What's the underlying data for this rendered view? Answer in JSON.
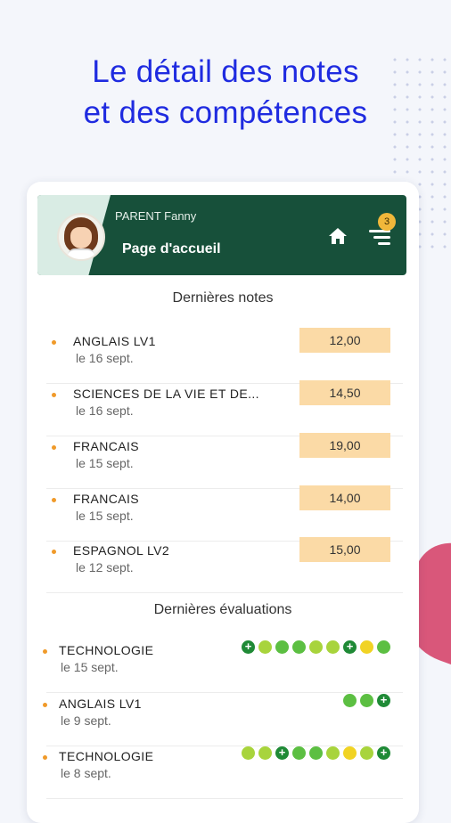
{
  "headline": {
    "line1": "Le détail des notes",
    "line2": "et des compétences"
  },
  "header": {
    "user": "PARENT Fanny",
    "page_title": "Page d'accueil",
    "notification_count": "3"
  },
  "notes": {
    "title": "Dernières notes",
    "items": [
      {
        "subject": "ANGLAIS LV1",
        "date": "le 16 sept.",
        "grade": "12,00"
      },
      {
        "subject": "SCIENCES DE LA VIE ET DE...",
        "date": "le 16 sept.",
        "grade": "14,50"
      },
      {
        "subject": "FRANCAIS",
        "date": "le 15 sept.",
        "grade": "19,00"
      },
      {
        "subject": "FRANCAIS",
        "date": "le 15 sept.",
        "grade": "14,00"
      },
      {
        "subject": "ESPAGNOL LV2",
        "date": "le 12 sept.",
        "grade": "15,00"
      }
    ]
  },
  "evaluations": {
    "title": "Dernières évaluations",
    "items": [
      {
        "subject": "TECHNOLOGIE",
        "date": "le 15 sept.",
        "levels": [
          "plus",
          "light",
          "mid",
          "mid",
          "light",
          "light",
          "plus",
          "yellow",
          "mid"
        ]
      },
      {
        "subject": "ANGLAIS LV1",
        "date": "le 9 sept.",
        "levels": [
          "mid",
          "mid",
          "plus"
        ]
      },
      {
        "subject": "TECHNOLOGIE",
        "date": "le 8 sept.",
        "levels": [
          "light",
          "light",
          "plus",
          "mid",
          "mid",
          "light",
          "yellow",
          "light",
          "plus"
        ]
      }
    ]
  },
  "colors": {
    "headline": "#1f2be0",
    "header_bg": "#17503a",
    "grade_bg": "#fbdaa6",
    "bullet": "#f09a2a",
    "level_plus": "#1f8a36",
    "level_mid": "#5cbf42",
    "level_light": "#a8d43c",
    "level_yellow": "#f1d324"
  },
  "icons": {
    "home": "home-icon",
    "menu": "menu-icon",
    "avatar": "avatar"
  }
}
